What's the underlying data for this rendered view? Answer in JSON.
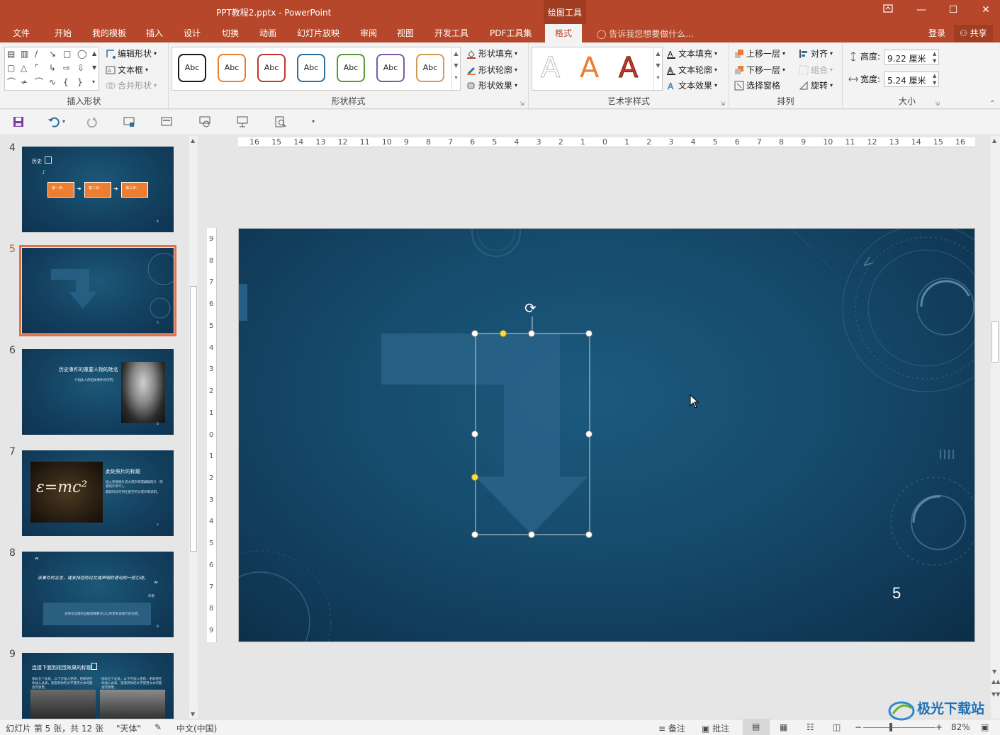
{
  "window": {
    "title": "PPT教程2.pptx - PowerPoint",
    "context_group": "绘图工具"
  },
  "tabs": [
    {
      "label": "文件"
    },
    {
      "label": "开始"
    },
    {
      "label": "我的模板"
    },
    {
      "label": "插入"
    },
    {
      "label": "设计"
    },
    {
      "label": "切换"
    },
    {
      "label": "动画"
    },
    {
      "label": "幻灯片放映"
    },
    {
      "label": "审阅"
    },
    {
      "label": "视图"
    },
    {
      "label": "开发工具"
    },
    {
      "label": "PDF工具集"
    },
    {
      "label": "格式",
      "active": true
    }
  ],
  "tell_me": "告诉我您想要做什么...",
  "login": "登录",
  "share": "共享",
  "ribbon": {
    "insert_shapes": {
      "label": "插入形状",
      "edit_shape": "编辑形状",
      "text_box": "文本框",
      "merge_shapes": "合并形状"
    },
    "shape_styles": {
      "label": "形状样式",
      "gallery_text": "Abc",
      "gallery_colors": [
        "#1a1a1a",
        "#ed7d31",
        "#c0392b",
        "#2e6f9e",
        "#5a9a3a",
        "#7b5aa6",
        "#d49b4a"
      ],
      "fill": "形状填充",
      "outline": "形状轮廓",
      "effects": "形状效果"
    },
    "wordart_styles": {
      "label": "艺术字样式",
      "glyph": "A",
      "text_fill": "文本填充",
      "text_outline": "文本轮廓",
      "text_effects": "文本效果"
    },
    "arrange": {
      "label": "排列",
      "bring_forward": "上移一层",
      "send_backward": "下移一层",
      "selection_pane": "选择窗格",
      "align": "对齐",
      "group": "组合",
      "rotate": "旋转"
    },
    "size": {
      "label": "大小",
      "height_label": "高度:",
      "height_value": "9.22 厘米",
      "width_label": "宽度:",
      "width_value": "5.24 厘米"
    }
  },
  "thumbnails": [
    {
      "num": "4",
      "title": "历史",
      "steps": [
        "第一步:",
        "第二步:",
        "第三步:"
      ],
      "page": "4"
    },
    {
      "num": "5",
      "selected": true,
      "page": "5"
    },
    {
      "num": "6",
      "title": "历史事件的重要人物的姓名",
      "sub": "介绍此人的相关事件的作用。",
      "page": "6"
    },
    {
      "num": "7",
      "title": "此处照片的标题",
      "sub1": "插入更换图片说文或声明或编辑照片（作者照片简介）。",
      "sub2": "最新时间可到任意空的文或声明说明。",
      "page": "7"
    },
    {
      "num": "8",
      "quote": "该事件的名言，或支持您的论文或声明的语句的一段引述。",
      "author": "作者",
      "box_text": "支持论证理的证据或摘要可以让你更有说服力的东西。",
      "page": "8"
    },
    {
      "num": "9",
      "title": "连接下面到视觉效果的标题",
      "col_text": "指标五个此处，以下方加入更新，更新将在你加入此表，逐渐到你的文字使用文本可能会完善更。"
    }
  ],
  "ruler": {
    "h_ticks": [
      "16",
      "15",
      "14",
      "13",
      "12",
      "11",
      "10",
      "9",
      "8",
      "7",
      "6",
      "5",
      "4",
      "3",
      "2",
      "1",
      "0",
      "1",
      "2",
      "3",
      "4",
      "5",
      "6",
      "7",
      "8",
      "9",
      "10",
      "11",
      "12",
      "13",
      "14",
      "15",
      "16"
    ],
    "v_ticks": [
      "9",
      "8",
      "7",
      "6",
      "5",
      "4",
      "3",
      "2",
      "1",
      "0",
      "1",
      "2",
      "3",
      "4",
      "5",
      "6",
      "7",
      "8",
      "9"
    ]
  },
  "slide": {
    "page_number": "5",
    "background_color": "#164b6c",
    "arrow_color": "#2a6388"
  },
  "status": {
    "slide_info": "幻灯片 第 5 张，共 12 张",
    "theme": "\"天体\"",
    "language": "中文(中国)",
    "notes": "备注",
    "comments": "批注",
    "zoom": "82%"
  },
  "watermark": "极光下载站"
}
